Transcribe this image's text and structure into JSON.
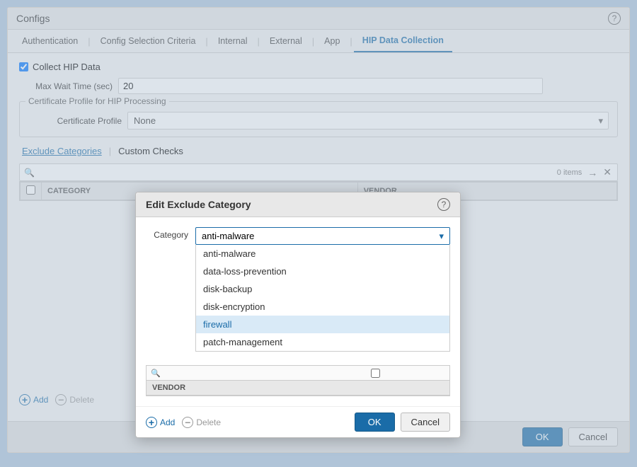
{
  "panel": {
    "title": "Configs",
    "help_label": "?"
  },
  "tabs": [
    {
      "id": "authentication",
      "label": "Authentication",
      "active": false
    },
    {
      "id": "config-selection",
      "label": "Config Selection Criteria",
      "active": false
    },
    {
      "id": "internal",
      "label": "Internal",
      "active": false
    },
    {
      "id": "external",
      "label": "External",
      "active": false
    },
    {
      "id": "app",
      "label": "App",
      "active": false
    },
    {
      "id": "hip-data-collection",
      "label": "HIP Data Collection",
      "active": true
    }
  ],
  "collect_hip_data": {
    "label": "Collect HIP Data",
    "checked": true
  },
  "max_wait_time": {
    "label": "Max Wait Time (sec)",
    "value": "20"
  },
  "cert_profile_group": {
    "title": "Certificate Profile for HIP Processing",
    "label": "Certificate Profile",
    "value": "None"
  },
  "sub_tabs": [
    {
      "id": "exclude-categories",
      "label": "Exclude Categories",
      "active": true
    },
    {
      "id": "custom-checks",
      "label": "Custom Checks",
      "active": false
    }
  ],
  "search": {
    "placeholder": "",
    "items_count": "0 items"
  },
  "table": {
    "columns": [
      "CATEGORY",
      "VENDOR"
    ]
  },
  "bottom_actions": {
    "add_label": "Add",
    "delete_label": "Delete"
  },
  "footer": {
    "ok_label": "OK",
    "cancel_label": "Cancel"
  },
  "modal": {
    "title": "Edit Exclude Category",
    "help_label": "?",
    "category_label": "Category",
    "category_value": "anti-malware",
    "dropdown_options": [
      {
        "value": "anti-malware",
        "label": "anti-malware",
        "selected": true
      },
      {
        "value": "data-loss-prevention",
        "label": "data-loss-prevention",
        "selected": false
      },
      {
        "value": "disk-backup",
        "label": "disk-backup",
        "selected": false
      },
      {
        "value": "disk-encryption",
        "label": "disk-encryption",
        "selected": false
      },
      {
        "value": "firewall",
        "label": "firewall",
        "selected": true,
        "highlighted": true
      },
      {
        "value": "patch-management",
        "label": "patch-management",
        "selected": false
      }
    ],
    "inner_table": {
      "columns": [
        "VENDOR"
      ]
    },
    "add_label": "Add",
    "delete_label": "Delete",
    "ok_label": "OK",
    "cancel_label": "Cancel"
  }
}
